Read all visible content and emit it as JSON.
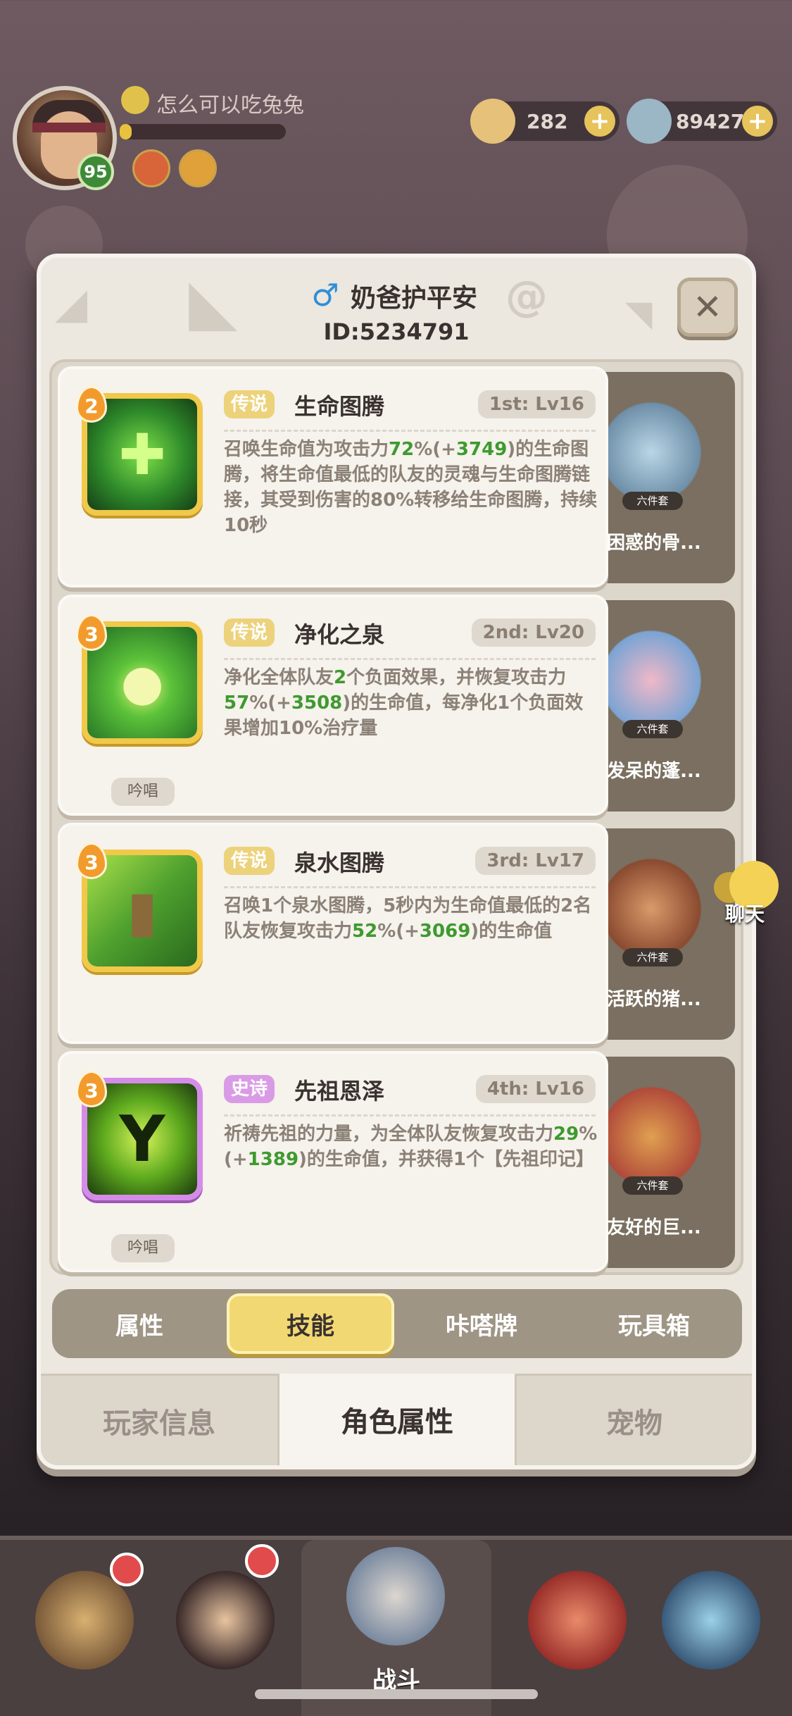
{
  "hud": {
    "player_name": "怎么可以吃兔兔",
    "level": "95",
    "xp_progress": 0.07,
    "currency_shells": "282",
    "currency_gems": "89427"
  },
  "panel": {
    "nickname": "奶爸护平安",
    "player_id": "ID:5234791",
    "close_label": "✕"
  },
  "skills": [
    {
      "cost": "2",
      "rarity": "传说",
      "name": "生命图腾",
      "slot": "1st: Lv16",
      "desc_parts": [
        "召唤生命值为攻击力",
        "72",
        "%(+",
        "3749",
        ")的生命图腾，将生命值最低的队友的灵魂与生命图腾链接，其受到伤害的80%转移给生命图腾，持续10秒"
      ],
      "chant": "",
      "pet_name": "困惑的骨...",
      "pet_tag": "六件套"
    },
    {
      "cost": "3",
      "rarity": "传说",
      "name": "净化之泉",
      "slot": "2nd: Lv20",
      "desc_parts": [
        "净化全体队友",
        "2",
        "个负面效果，并恢复攻击力",
        "57",
        "%(+",
        "3508",
        ")的生命值，每净化1个负面效果增加10%治疗量"
      ],
      "chant": "吟唱",
      "pet_name": "发呆的蓬...",
      "pet_tag": "六件套"
    },
    {
      "cost": "3",
      "rarity": "传说",
      "name": "泉水图腾",
      "slot": "3rd: Lv17",
      "desc_parts": [
        "召唤1个泉水图腾，5秒内为生命值最低的2名队友恢复攻击力",
        "52",
        "%(+",
        "3069",
        ")的生命值"
      ],
      "chant": "",
      "pet_name": "活跃的猪...",
      "pet_tag": "六件套"
    },
    {
      "cost": "3",
      "rarity": "史诗",
      "name": "先祖恩泽",
      "slot": "4th: Lv16",
      "desc_parts": [
        "祈祷先祖的力量，为全体队友恢复攻击力",
        "29",
        "%(+",
        "1389",
        ")的生命值，并获得1个【先祖印记】"
      ],
      "chant": "吟唱",
      "pet_name": "友好的巨...",
      "pet_tag": "六件套"
    }
  ],
  "sub_tabs": [
    "属性",
    "技能",
    "咔嗒牌",
    "玩具箱"
  ],
  "sub_tab_active": 1,
  "main_tabs": [
    "玩家信息",
    "角色属性",
    "宠物"
  ],
  "main_tab_active": 1,
  "chat_label": "聊天",
  "bottom_nav": {
    "battle_label": "战斗"
  },
  "colors": {
    "legend_rarity": "#ecd27a",
    "epic_rarity": "#d99be6",
    "value_green": "#3e9a2e",
    "active_tab": "#f1d873"
  }
}
